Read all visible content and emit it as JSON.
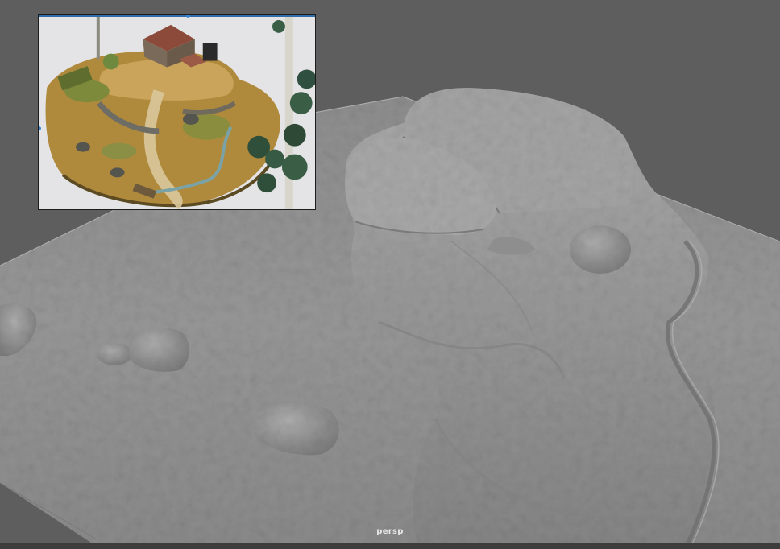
{
  "viewport": {
    "camera_label": "persp",
    "background_color": "#5e5e5e",
    "mesh_color": "#9a9a9a"
  },
  "reference_image": {
    "description_icon": "image-plane-icon",
    "accent_color": "#2f6ea8"
  }
}
